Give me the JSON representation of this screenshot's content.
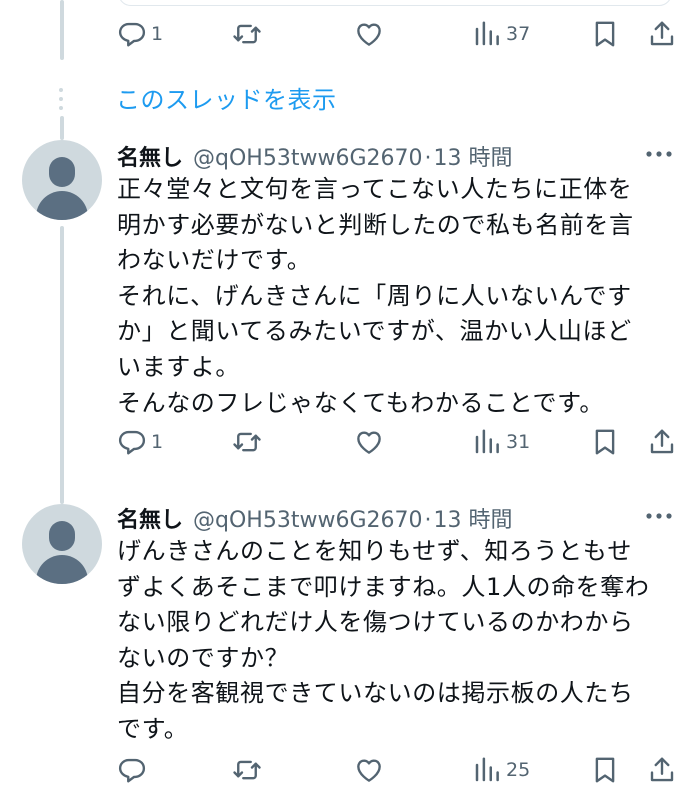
{
  "colors": {
    "accent": "#1d9bf0",
    "text_primary": "#0f1419",
    "text_secondary": "#536471",
    "thread_line": "#cfd9de"
  },
  "top_actions": {
    "reply_count": "1",
    "retweet_count": "",
    "like_count": "",
    "views_count": "37"
  },
  "show_thread_label": "このスレッドを表示",
  "tweets": [
    {
      "name": "名無し",
      "handle": "@qOH53tww6G2670",
      "separator": "·",
      "time": "13 時間",
      "text": "正々堂々と文句を言ってこない人たちに正体を\n明かす必要がないと判断したので私も名前を言\nわないだけです。\nそれに、げんきさんに「周りに人いないんです\nか」と聞いてるみたいですが、温かい人山ほど\nいますよ。\nそんなのフレじゃなくてもわかることです。",
      "reply_count": "1",
      "retweet_count": "",
      "like_count": "",
      "views_count": "31"
    },
    {
      "name": "名無し",
      "handle": "@qOH53tww6G2670",
      "separator": "·",
      "time": "13 時間",
      "text": "げんきさんのことを知りもせず、知ろうともせ\nずよくあそこまで叩けますね。人1人の命を奪わ\nない限りどれだけ人を傷つけているのかわから\nないのですか？\n自分を客観視できていないのは掲示板の人たち\nです。",
      "reply_count": "",
      "retweet_count": "",
      "like_count": "",
      "views_count": "25"
    }
  ],
  "icons": [
    "reply-icon",
    "retweet-icon",
    "like-icon",
    "views-icon",
    "bookmark-icon",
    "share-icon",
    "more-icon",
    "avatar-default-icon"
  ]
}
